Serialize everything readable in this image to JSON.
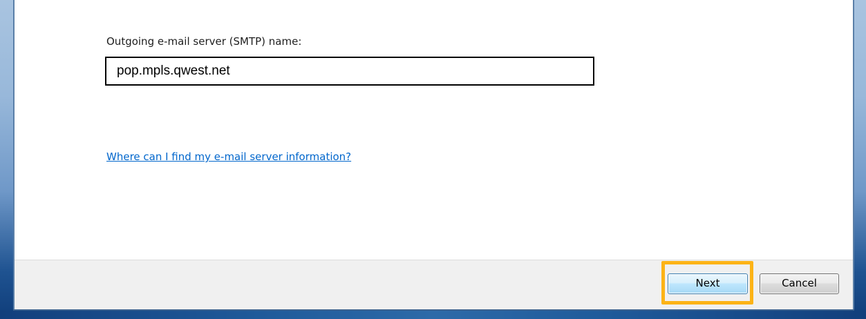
{
  "form": {
    "smtp_label": "Outgoing e-mail server (SMTP) name:",
    "smtp_value": "pop.mpls.qwest.net",
    "help_link": "Where can I find my e-mail server information?"
  },
  "footer": {
    "next_label": "Next",
    "cancel_label": "Cancel"
  },
  "colors": {
    "link": "#0066cc",
    "highlight": "#fcb316",
    "frame": "#1f5391"
  }
}
